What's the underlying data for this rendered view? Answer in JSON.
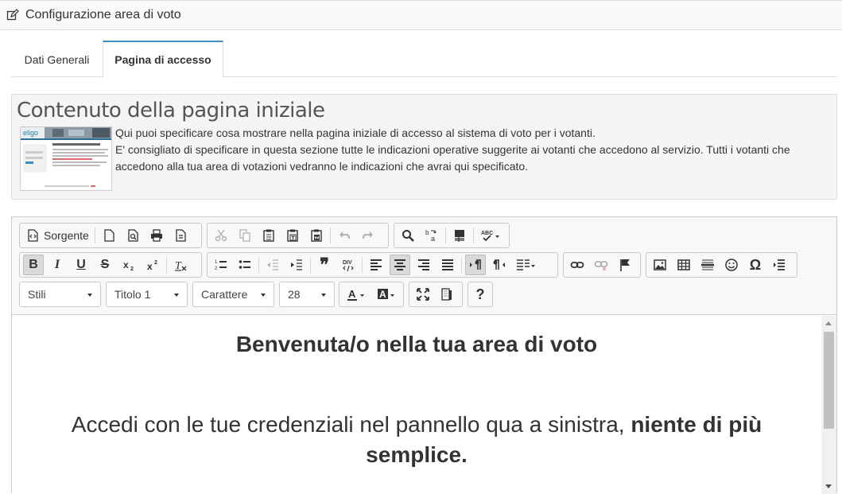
{
  "header": {
    "title": "Configurazione area di voto",
    "icon": "edit-icon"
  },
  "tabs": [
    {
      "label": "Dati Generali",
      "active": false
    },
    {
      "label": "Pagina di accesso",
      "active": true
    }
  ],
  "info": {
    "title": "Contenuto della pagina iniziale",
    "paragraph1": "Qui puoi specificare cosa mostrare nella pagina iniziale di accesso al sistema di voto per i votanti.",
    "paragraph2": "E' consigliato di specificare in questa sezione tutte le indicazioni operative suggerite ai votanti che accedono al servizio. Tutti i votanti che accedono alla tua area di votazioni vedranno le indicazioni che avrai qui specificato.",
    "thumbnail_logo": "eligo"
  },
  "toolbar": {
    "source_label": "Sorgente",
    "combos": {
      "styles": "Stili",
      "format": "Titolo 1",
      "font": "Carattere",
      "size": "28"
    },
    "help_label": "?"
  },
  "content": {
    "heading": "Benvenuta/o nella tua area di voto",
    "lead_normal": "Accedi con le tue credenziali nel pannello qua a sinistra, ",
    "lead_bold": "niente di più semplice."
  },
  "colors": {
    "tab_accent": "#3c8dbc",
    "toolbar_bg": "#f8f8f8"
  }
}
